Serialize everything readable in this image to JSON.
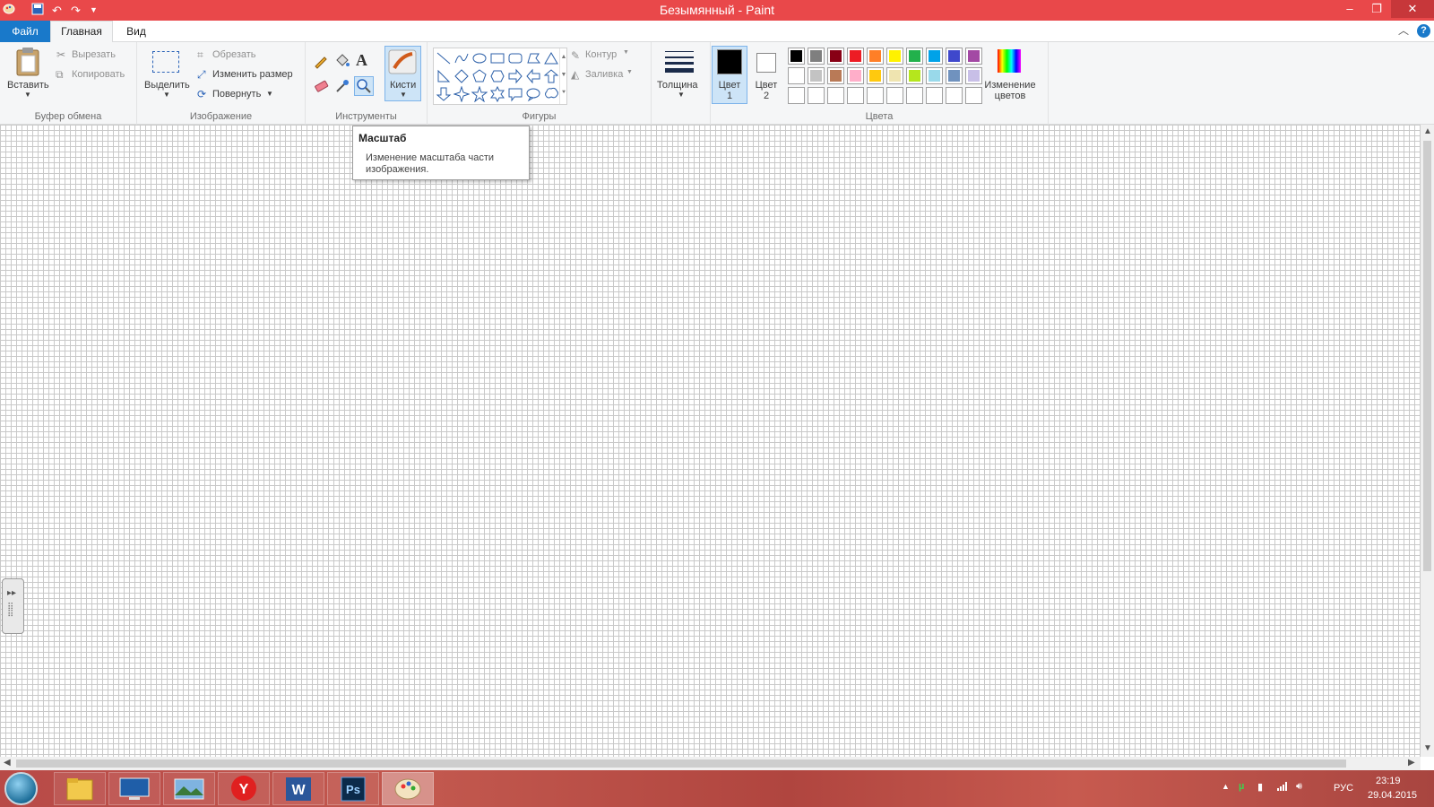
{
  "window": {
    "title": "Безымянный - Paint",
    "minimize": "‒",
    "restore": "❐",
    "close": "✕"
  },
  "quick_access": [
    "save-icon",
    "undo-icon",
    "redo-icon",
    "customize-icon"
  ],
  "tabs": [
    {
      "label": "Файл"
    },
    {
      "label": "Главная"
    },
    {
      "label": "Вид"
    }
  ],
  "ribbon": {
    "clipboard": {
      "paste": "Вставить",
      "cut": "Вырезать",
      "copy": "Копировать",
      "label": "Буфер обмена"
    },
    "image": {
      "select": "Выделить",
      "crop": "Обрезать",
      "resize": "Изменить размер",
      "rotate": "Повернуть",
      "label": "Изображение"
    },
    "tools": {
      "label": "Инструменты",
      "items": [
        "pencil-icon",
        "fill-icon",
        "text-icon",
        "eraser-icon",
        "color-picker-icon",
        "magnifier-icon"
      ]
    },
    "brushes": {
      "label": "Кисти"
    },
    "shapes": {
      "label": "Фигуры",
      "outline": "Контур",
      "fill": "Заливка"
    },
    "size": {
      "label": "Толщина"
    },
    "colors": {
      "color1": "Цвет 1",
      "color2": "Цвет 2",
      "color1_value": "#000000",
      "color2_value": "#ffffff",
      "edit_colors": "Изменение цветов",
      "label": "Цвета",
      "palette_row1": [
        "#000000",
        "#7f7f7f",
        "#880015",
        "#ed1c24",
        "#ff7f27",
        "#fff200",
        "#22b14c",
        "#00a2e8",
        "#3f48cc",
        "#a349a4"
      ],
      "palette_row2": [
        "#ffffff",
        "#c3c3c3",
        "#b97a57",
        "#ffaec9",
        "#ffc90e",
        "#efe4b0",
        "#b5e61d",
        "#99d9ea",
        "#7092be",
        "#c8bfe7"
      ]
    }
  },
  "tooltip": {
    "title": "Масштаб",
    "description": "Изменение масштаба части изображения."
  },
  "tray": {
    "language": "РУС",
    "time": "23:19",
    "date": "29.04.2015"
  }
}
